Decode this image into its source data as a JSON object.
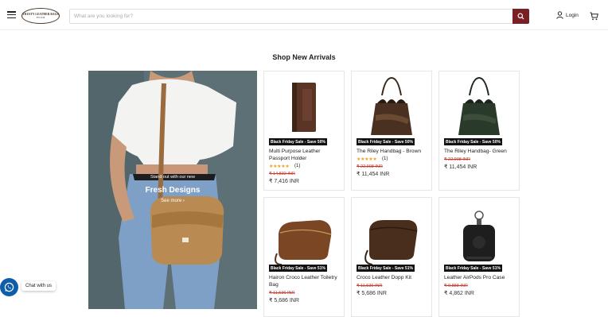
{
  "header": {
    "logo_line1": "TRUSTY LEATHER BAGS",
    "logo_line2": "EST 2016",
    "search_placeholder": "What are you looking for?",
    "login_label": "Login",
    "accent_color": "#7a1f23"
  },
  "section": {
    "title": "Shop New Arrivals"
  },
  "hero": {
    "eyebrow": "Stand out with our new",
    "headline": "Fresh Designs",
    "link": "See more ›"
  },
  "products": [
    {
      "badge": "Black Friday Sale - Save 50%",
      "name": "Multi Purpose Leather Passport Holder",
      "stars": "★★★★★",
      "reviews": "(1)",
      "old_price": "₹ 14,832 INR",
      "price": "₹ 7,416 INR"
    },
    {
      "badge": "Black Friday Sale - Save 50%",
      "name": "The Riley Handbag - Brown",
      "stars": "★★★★★",
      "reviews": "(1)",
      "old_price": "₹ 22,908 INR",
      "price": "₹ 11,454 INR"
    },
    {
      "badge": "Black Friday Sale - Save 50%",
      "name": "The Riley Handbag- Green",
      "old_price": "₹ 22,908 INR",
      "price": "₹ 11,454 INR"
    },
    {
      "badge": "Black Friday Sale - Save 51%",
      "name": "Hairon Croco Leather Toiletry Bag",
      "old_price": "₹ 11,536 INR",
      "price": "₹ 5,686 INR"
    },
    {
      "badge": "Black Friday Sale - Save 51%",
      "name": "Croco Leather Dopp Kit",
      "old_price": "₹ 11,536 INR",
      "price": "₹ 5,686 INR"
    },
    {
      "badge": "Black Friday Sale - Save 51%",
      "name": "Leather AirPods Pro Case",
      "old_price": "₹ 9,888 INR",
      "price": "₹ 4,862 INR"
    }
  ],
  "chat": {
    "label": "Chat with us",
    "color": "#0e5dab"
  }
}
